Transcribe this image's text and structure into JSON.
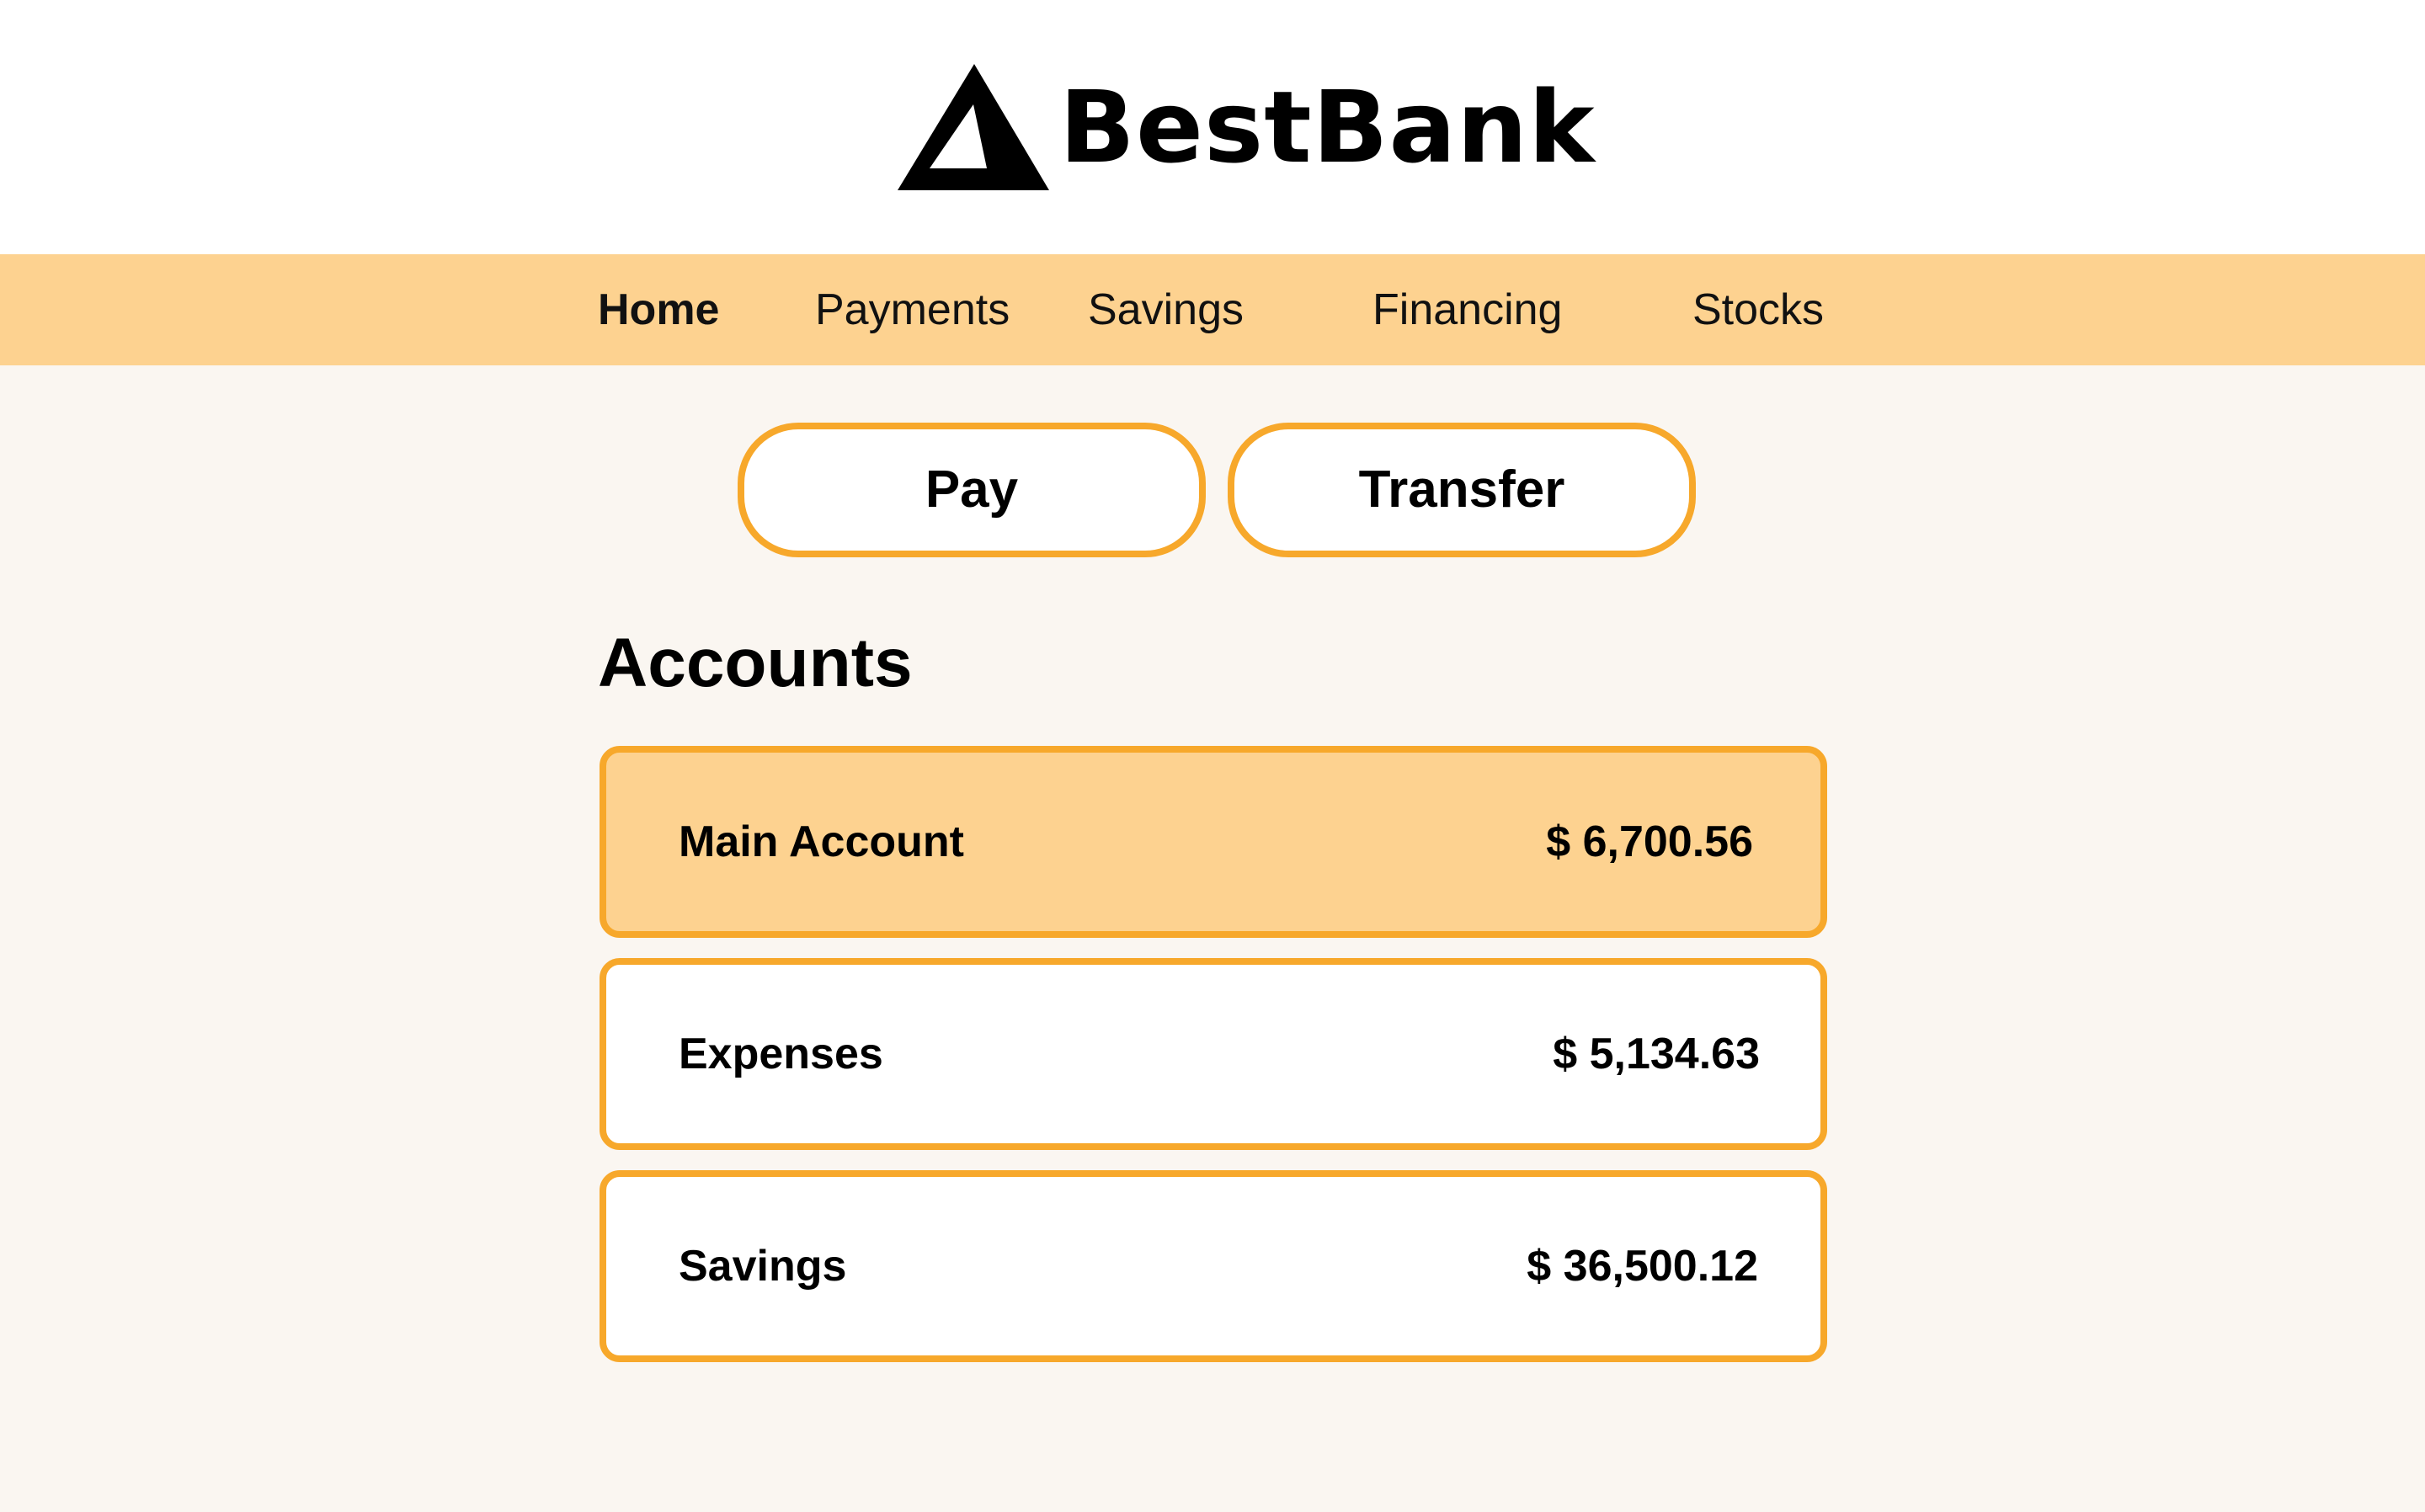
{
  "brand": {
    "name": "BestBank",
    "logo_icon": "triangle-logo-icon"
  },
  "nav": {
    "items": [
      {
        "label": "Home",
        "active": true
      },
      {
        "label": "Payments",
        "active": false
      },
      {
        "label": "Savings",
        "active": false
      },
      {
        "label": "Financing",
        "active": false
      },
      {
        "label": "Stocks",
        "active": false
      }
    ]
  },
  "actions": {
    "pay_label": "Pay",
    "transfer_label": "Transfer"
  },
  "accounts": {
    "title": "Accounts",
    "items": [
      {
        "name": "Main Account",
        "balance": "$ 6,700.56",
        "selected": true
      },
      {
        "name": "Expenses",
        "balance": "$ 5,134.63",
        "selected": false
      },
      {
        "name": "Savings",
        "balance": "$ 36,500.12",
        "selected": false
      }
    ]
  },
  "colors": {
    "accent": "#f7a82b",
    "nav_background": "#fdd290",
    "page_background": "#faf6f1",
    "header_background": "#ffffff"
  }
}
